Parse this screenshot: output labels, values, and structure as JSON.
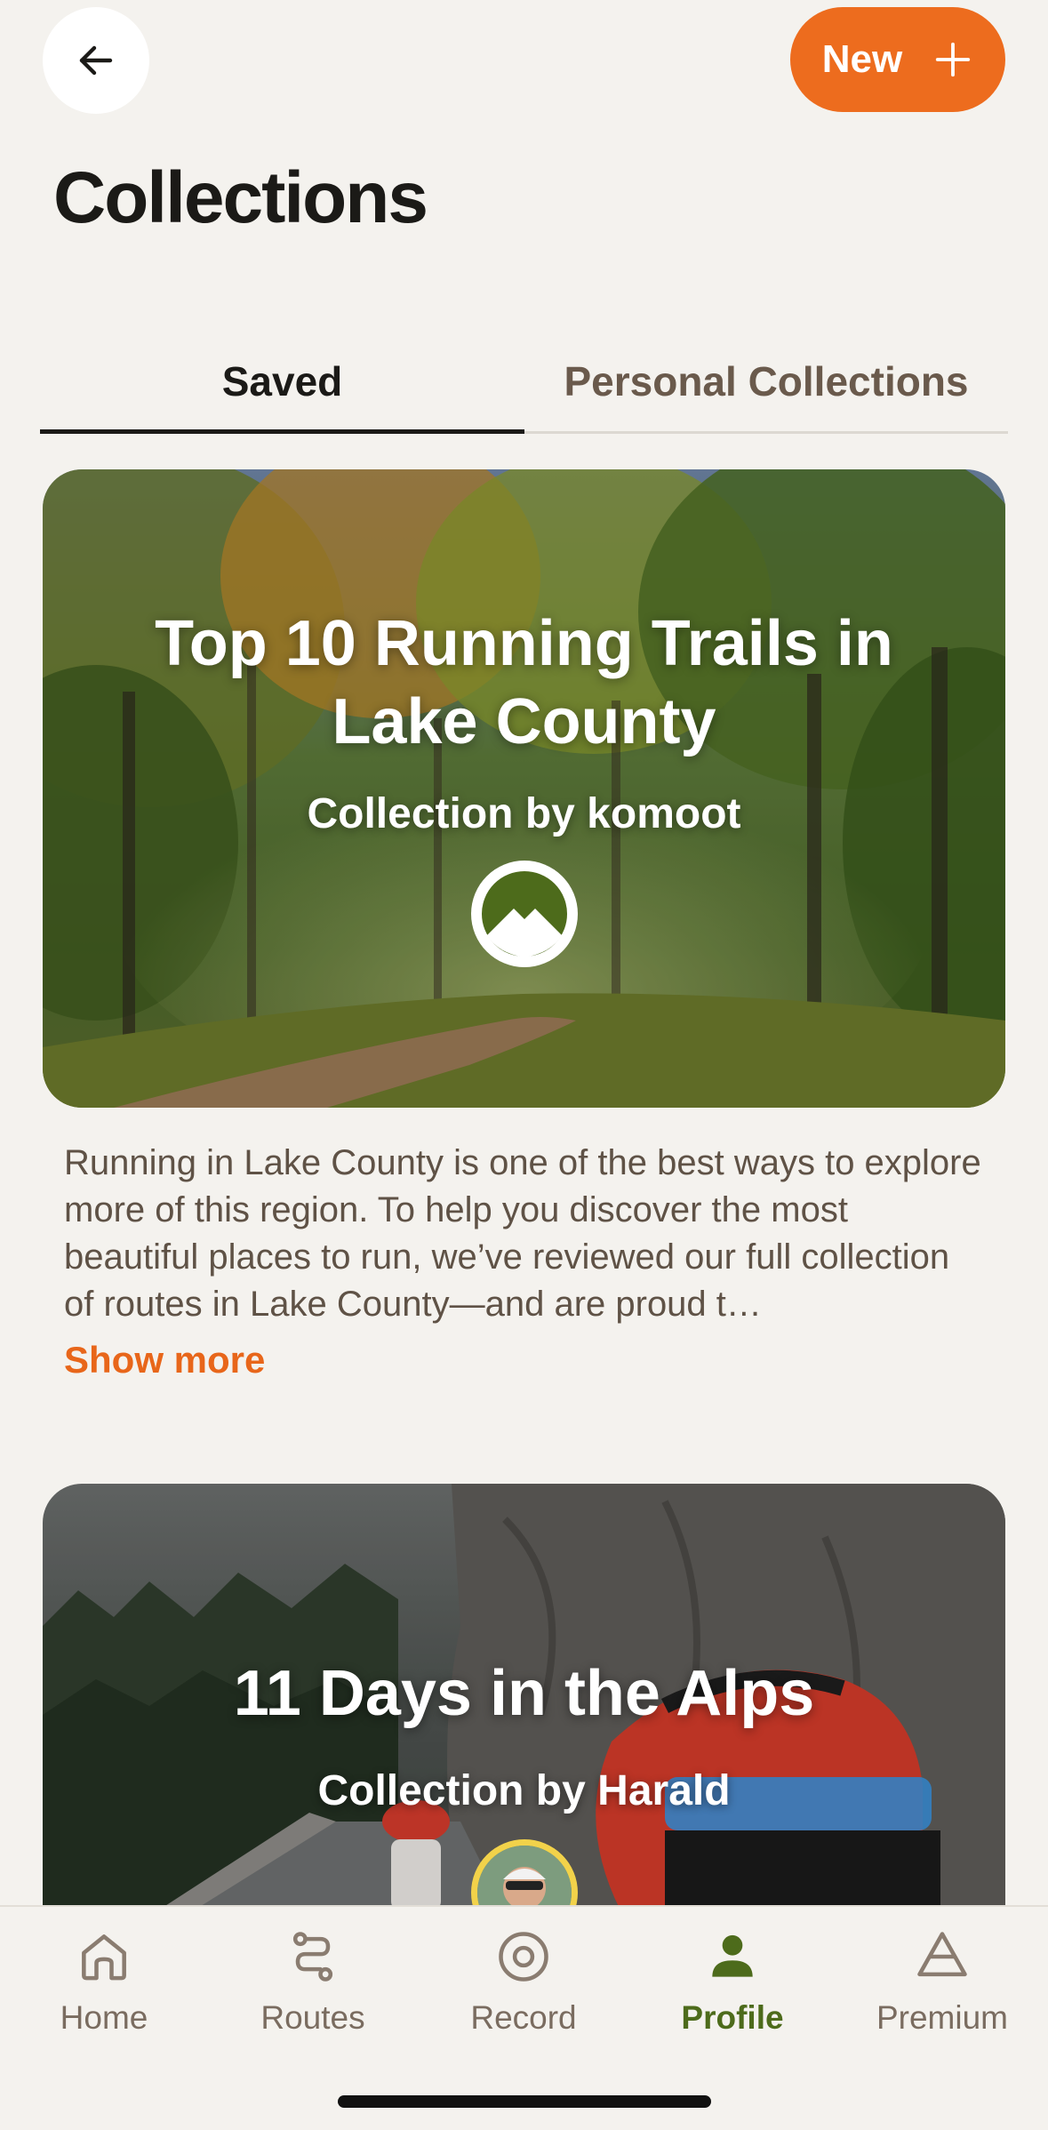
{
  "header": {
    "back_icon": "arrow-left-icon",
    "new_button_label": "New",
    "new_button_icon": "plus-icon",
    "title": "Collections"
  },
  "tabs": [
    {
      "label": "Saved",
      "active": true
    },
    {
      "label": "Personal Collections",
      "active": false
    }
  ],
  "collections": [
    {
      "title": "Top 10 Running Trails in Lake County",
      "subtitle": "Collection by komoot",
      "author_icon": "komoot-logo-icon",
      "description": "Running in Lake County is one of the best ways to explore more of this region. To help you discover the most beautiful places to run, we’ve reviewed our full collection of routes in Lake County—and are proud t…",
      "show_more": "Show more"
    },
    {
      "title": "11 Days in the Alps",
      "subtitle": "Collection by Harald",
      "author_icon": "author-avatar"
    }
  ],
  "nav": [
    {
      "label": "Home",
      "icon": "home-icon",
      "active": false
    },
    {
      "label": "Routes",
      "icon": "routes-icon",
      "active": false
    },
    {
      "label": "Record",
      "icon": "record-icon",
      "active": false
    },
    {
      "label": "Profile",
      "icon": "profile-icon",
      "active": true
    },
    {
      "label": "Premium",
      "icon": "premium-icon",
      "active": false
    }
  ],
  "colors": {
    "accent": "#ed6c1e",
    "active_nav": "#4d6b1b",
    "background": "#f4f2ee"
  }
}
